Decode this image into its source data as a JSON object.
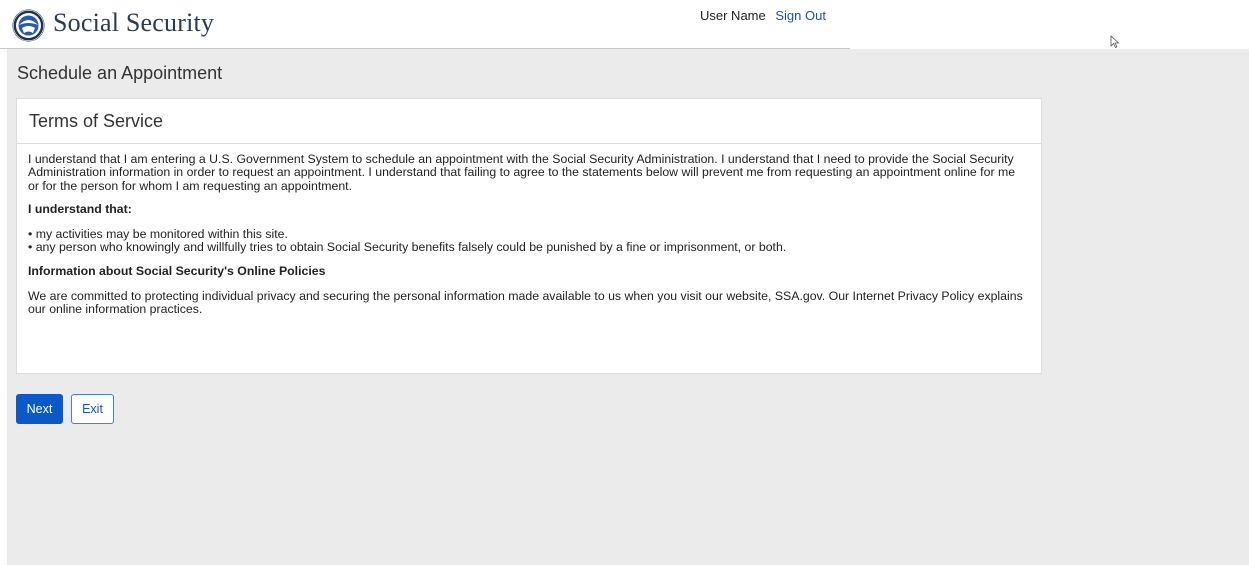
{
  "header": {
    "brand": "Social Security",
    "logo_icon": "ssa-seal-icon",
    "user_name": "User Name",
    "sign_out": "Sign Out"
  },
  "page": {
    "title": "Schedule an Appointment"
  },
  "terms": {
    "title": "Terms of Service",
    "intro": "I understand that I am entering a U.S. Government System to schedule an appointment with the Social Security Administration. I understand that I need to provide the Social Security Administration information in order to request an appointment. I understand that failing to agree to the statements below will prevent me from requesting an appointment online for me or for the person for whom I am requesting an appointment.",
    "understand_heading": "I understand that:",
    "bullets": [
      "• my activities may be monitored within this site.",
      "• any person who knowingly and willfully tries to obtain Social Security benefits falsely could be punished by a fine or imprisonment, or both."
    ],
    "policies_heading": "Information about Social Security's Online Policies",
    "policies_text": "We are committed to protecting individual privacy and securing the personal information made available to us when you visit our website, SSA.gov. Our Internet Privacy Policy explains our online information practices."
  },
  "actions": {
    "next_label": "Next",
    "exit_label": "Exit"
  },
  "colors": {
    "primary": "#0b58c9",
    "link": "#1a4fc4",
    "background": "#ebebeb",
    "brand_text": "#2b3a55"
  }
}
